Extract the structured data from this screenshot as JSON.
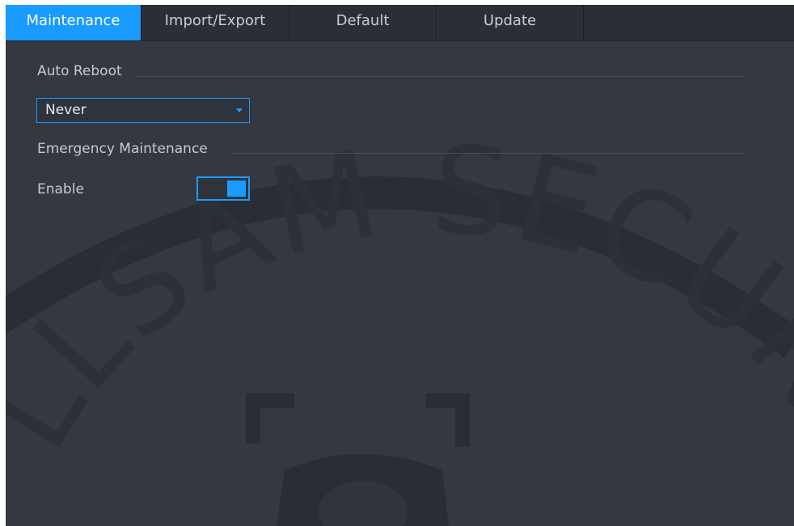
{
  "tabs": [
    {
      "label": "Maintenance",
      "active": true
    },
    {
      "label": "Import/Export",
      "active": false
    },
    {
      "label": "Default",
      "active": false
    },
    {
      "label": "Update",
      "active": false
    }
  ],
  "auto_reboot": {
    "title": "Auto Reboot",
    "selected": "Never"
  },
  "emergency": {
    "title": "Emergency Maintenance",
    "enable_label": "Enable",
    "enabled": true
  },
  "watermark": {
    "text": "LLSAM SECURITY"
  },
  "colors": {
    "accent": "#1a9bff",
    "background": "#343841",
    "tabbar": "#2b2e35"
  }
}
